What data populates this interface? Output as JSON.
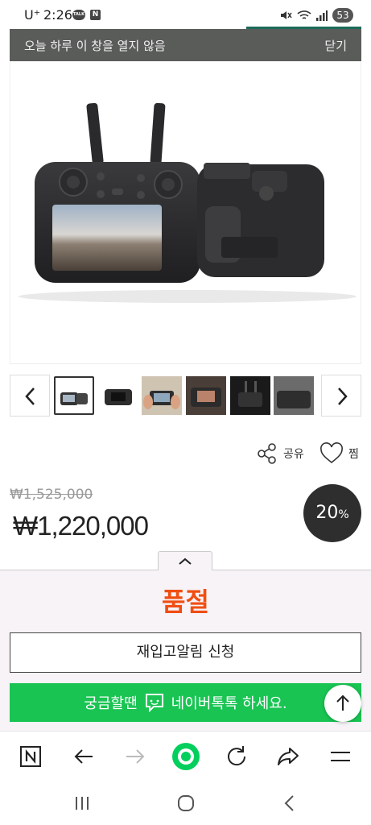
{
  "status_bar": {
    "carrier": "U⁺",
    "time": "2:26",
    "talk_badge": "TALK",
    "n_badge": "N",
    "battery": "53"
  },
  "notice": {
    "text": "오늘 하루 이 창을 열지 않음",
    "close_label": "닫기"
  },
  "product": {
    "share_label": "공유",
    "wish_label": "찜",
    "original_price": "₩1,525,000",
    "sale_price": "₩1,220,000",
    "discount_value": "20",
    "discount_unit": "%"
  },
  "purchase_sheet": {
    "status": "품절",
    "restock_button": "재입고알림 신청",
    "talk_button": "궁금할땐",
    "talk_button_suffix": "네이버톡톡 하세요."
  },
  "icons": {
    "colors": {
      "soldout": "#f04e12",
      "talk_green": "#19c453",
      "naver_green": "#03cf5d",
      "notice_bg": "#5a5c5a"
    }
  }
}
